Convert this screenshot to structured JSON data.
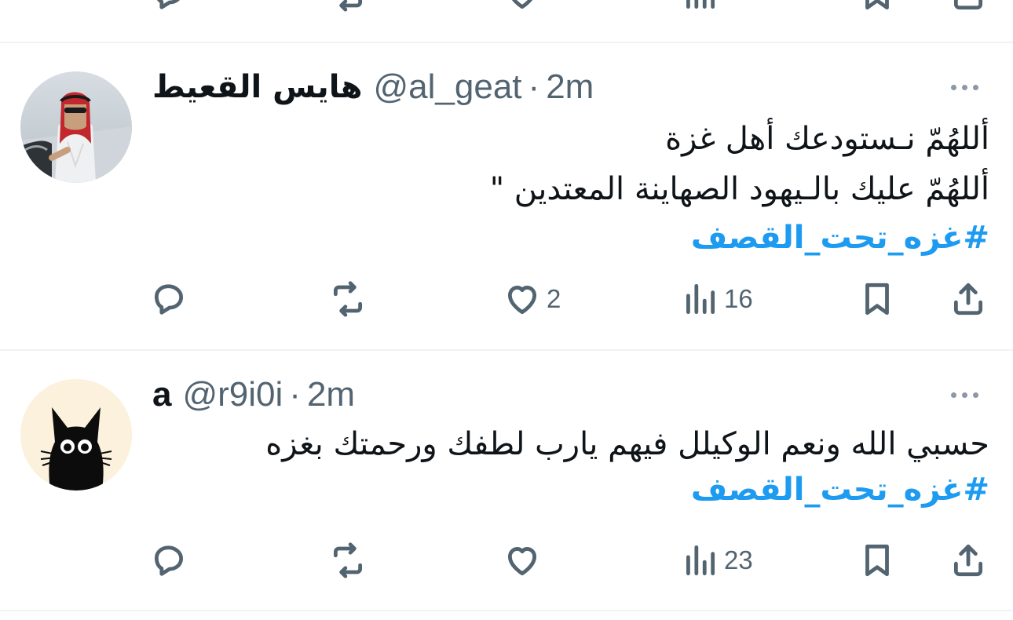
{
  "colors": {
    "accent": "#1d9bf0",
    "text": "#0f1419",
    "muted": "#536471",
    "divider": "#eff3f4"
  },
  "tweets": [
    {
      "name": "هايس القعيط",
      "handle": "@al_geat",
      "separator": "·",
      "time": "2m",
      "avatar": "avatar-man-in-shemagh",
      "lines": [
        "أللهُمّ نـستودعك أهل غزة",
        "أللهُمّ عليك بالـيهود الصهاينة المعتدين \""
      ],
      "hashtag": "#غزه_تحت_القصف",
      "replies": "",
      "reposts": "",
      "likes": "2",
      "views": "16"
    },
    {
      "name": "a",
      "handle": "@r9i0i",
      "separator": "·",
      "time": "2m",
      "avatar": "avatar-black-cat",
      "lines": [
        "حسبي الله ونعم الوكيلل فيهم يارب لطفك ورحمتك بغزه"
      ],
      "hashtag": "#غزه_تحت_القصف",
      "replies": "",
      "reposts": "",
      "likes": "",
      "views": "23"
    }
  ]
}
